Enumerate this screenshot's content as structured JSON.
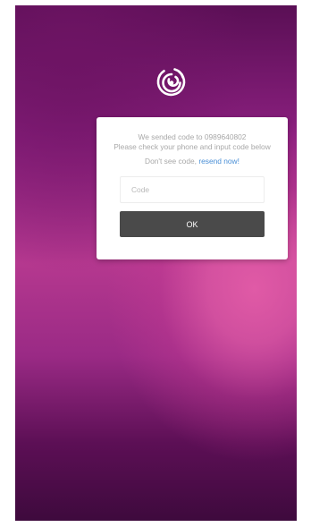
{
  "app": {
    "logo_icon": "concentric-circles-logo-icon",
    "background_colors": [
      "#5a0f55",
      "#b5388f",
      "#e05aa6",
      "#3e0a3d"
    ]
  },
  "verify_card": {
    "message_line1": "We sended code to 0989640802",
    "message_line2": "Please check your phone and input code below",
    "resend_prefix": "Don't see code, ",
    "resend_link": "resend now!",
    "code_input": {
      "placeholder": "Code",
      "value": ""
    },
    "ok_label": "OK",
    "ok_color": "#4a4a4a",
    "link_color": "#4a8fd6"
  }
}
